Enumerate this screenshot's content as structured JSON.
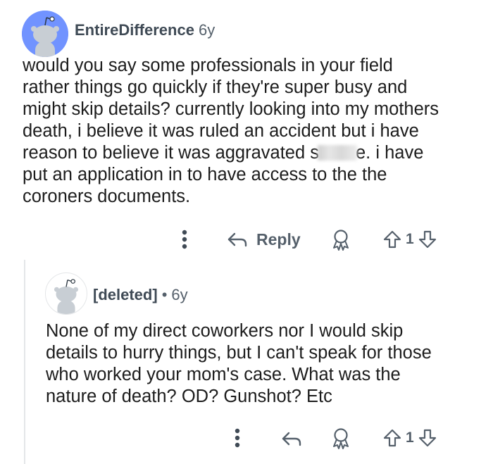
{
  "comment1": {
    "username": "EntireDifference",
    "age": "6y",
    "lines": [
      "would you say some professionals in your field",
      "rather things go quickly if they're super busy and",
      "might skip details? currently looking into my mothers",
      "death, i believe it was ruled an accident but i have",
      "reason to believe it was aggravated s",
      "e. i have",
      "put an application in to have access to the the",
      "coroners documents."
    ],
    "reply_label": "Reply",
    "vote_count": "1"
  },
  "comment2": {
    "username": "[deleted]",
    "separator": "•",
    "age": "6y",
    "lines": [
      "None of my direct coworkers nor I would skip",
      "details to hurry things, but I can't speak for those",
      "who worked your mom's case. What was the",
      "nature of death? OD? Gunshot? Etc"
    ],
    "vote_count": "1"
  },
  "icons": {
    "more": "more-vertical-icon",
    "reply": "reply-arrow-icon",
    "award": "award-icon",
    "upvote": "upvote-arrow-icon",
    "downvote": "downvote-arrow-icon",
    "avatar": "snoo-avatar-icon"
  },
  "colors": {
    "avatar1_bg": "#7193ff",
    "text": "#1c1c1c",
    "muted": "#55606b"
  }
}
